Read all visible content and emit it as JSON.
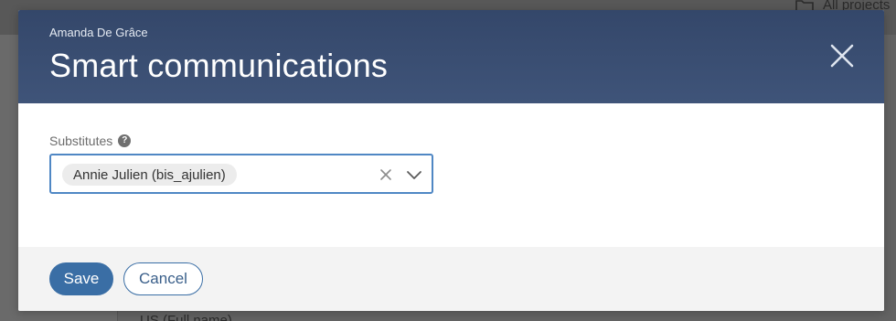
{
  "background": {
    "projects_link": "All projects",
    "bottom_text": "US (Full name)"
  },
  "modal": {
    "subtitle": "Amanda De Grâce",
    "title": "Smart communications",
    "close_icon": "close-icon",
    "field": {
      "label": "Substitutes",
      "help_icon": "help-icon",
      "help_glyph": "?",
      "selected": [
        "Annie Julien (bis_ajulien)"
      ]
    },
    "footer": {
      "save_label": "Save",
      "cancel_label": "Cancel"
    }
  },
  "colors": {
    "header_bg": "#3b4f73",
    "primary": "#3a6ea5",
    "focus_border": "#4f87c4",
    "footer_bg": "#f3f3f3",
    "chip_bg": "#ececec"
  }
}
